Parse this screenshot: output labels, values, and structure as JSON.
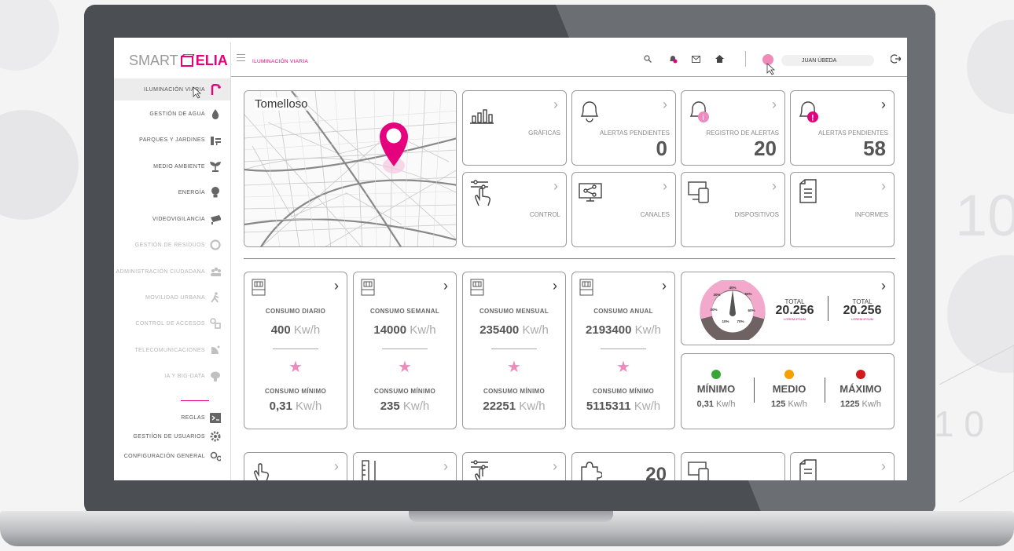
{
  "app": {
    "logo_part1": "SMART",
    "logo_part2": "ELIA"
  },
  "colors": {
    "accent": "#e5007e",
    "accent_soft": "#ee8abd",
    "green": "#3aa63a",
    "orange": "#f5a000",
    "red": "#d2191c"
  },
  "header": {
    "section_title": "ILUMINACIÓN VIARIA",
    "user_name": "JUAN ÚBEDA",
    "icons": [
      "search-icon",
      "bell-icon",
      "mail-icon",
      "home-icon",
      "logout-icon"
    ]
  },
  "sidebar": {
    "items": [
      {
        "label": "ILUMINACIÓN VIARIA",
        "icon": "streetlight-icon",
        "active": true
      },
      {
        "label": "GESTIÓN DE AGUA",
        "icon": "water-drop-icon"
      },
      {
        "label": "PARQUES Y JARDINES",
        "icon": "park-bench-icon"
      },
      {
        "label": "MEDIO AMBIENTE",
        "icon": "plant-icon"
      },
      {
        "label": "ENERGÍA",
        "icon": "bulb-icon"
      },
      {
        "label": "VIDEOVIGILANCIA",
        "icon": "camera-icon"
      },
      {
        "label": "GESTIÓN DE RESIDUOS",
        "icon": "recycle-icon",
        "disabled": true
      },
      {
        "label": "ADMINISTRACIÓN CIUDADANA",
        "icon": "people-icon",
        "disabled": true
      },
      {
        "label": "MOVILIDAD URBANA",
        "icon": "walking-icon",
        "disabled": true
      },
      {
        "label": "CONTROL DE ACCESOS",
        "icon": "access-icon",
        "disabled": true
      },
      {
        "label": "TELECOMUNICACIONES",
        "icon": "satellite-icon",
        "disabled": true
      },
      {
        "label": "IA Y BIG-DATA",
        "icon": "brain-icon",
        "disabled": true
      }
    ],
    "bottom": [
      {
        "label": "REGLAS",
        "icon": "terminal-icon"
      },
      {
        "label": "GESTIÍON DE USUARIOS",
        "icon": "gear-icon"
      },
      {
        "label": "CONFIGURACIÓN GENERAL",
        "icon": "settings-gears-icon"
      }
    ]
  },
  "map": {
    "city": "Tomelloso"
  },
  "tiles": {
    "graficas": "GRÁFICAS",
    "alertas1": {
      "label": "ALERTAS PENDIENTES",
      "value": "0"
    },
    "registro": {
      "label": "REGISTRO DE ALERTAS",
      "value": "20"
    },
    "alertas2": {
      "label": "ALERTAS PENDIENTES",
      "value": "58"
    },
    "control": "CONTROL",
    "canales": "CANALES",
    "dispositivos": "DISPOSITIVOS",
    "informes": "INFORMES"
  },
  "consumption": [
    {
      "title": "CONSUMO DIARIO",
      "value": "400",
      "unit": "Kw/h",
      "min_title": "CONSUMO MÍNIMO",
      "min_value": "0,31",
      "min_unit": "Kw/h"
    },
    {
      "title": "CONSUMO SEMANAL",
      "value": "14000",
      "unit": "Kw/h",
      "min_title": "CONSUMO MÍNIMO",
      "min_value": "235",
      "min_unit": "Kw/h"
    },
    {
      "title": "CONSUMO MENSUAL",
      "value": "235400",
      "unit": "Kw/h",
      "min_title": "CONSUMO MÍNIMO",
      "min_value": "22251",
      "min_unit": "Kw/h"
    },
    {
      "title": "CONSUMO ANUAL",
      "value": "2193400",
      "unit": "Kw/h",
      "min_title": "CONSUMO MÍNIMO",
      "min_value": "5115311",
      "min_unit": "Kw/h"
    }
  ],
  "gauge": {
    "ticks": [
      "40%",
      "50%",
      "30%",
      "20%",
      "60%",
      "10%",
      "70%"
    ],
    "needle": 0.4,
    "total1": {
      "label": "TOTAL",
      "value": "20.256",
      "sub": "LOREM IPSUM"
    },
    "total2": {
      "label": "TOTAL",
      "value": "20.256",
      "sub": "LOREM IPSUM"
    }
  },
  "levels": [
    {
      "label": "MÍNIMO",
      "value": "0,31",
      "unit": "Kw/h"
    },
    {
      "label": "MEDIO",
      "value": "125",
      "unit": "Kw/h"
    },
    {
      "label": "MÁXIMO",
      "value": "1225",
      "unit": "Kw/h"
    }
  ],
  "bottom_row": {
    "value": "20"
  }
}
